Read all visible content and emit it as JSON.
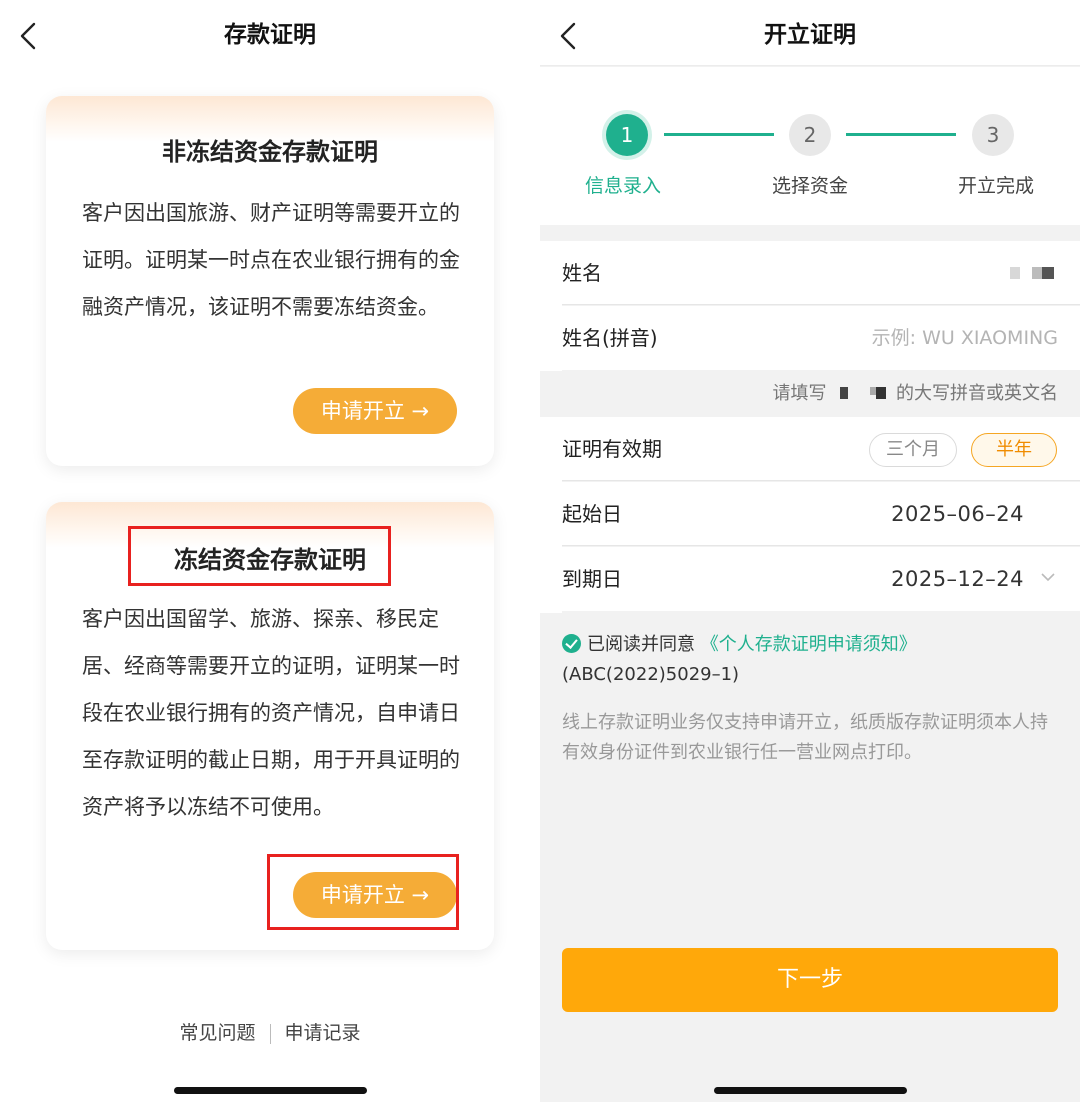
{
  "left": {
    "nav": {
      "title": "存款证明"
    },
    "card1": {
      "title": "非冻结资金存款证明",
      "description": "客户因出国旅游、财产证明等需要开立的证明。证明某一时点在农业银行拥有的金融资产情况，该证明不需要冻结资金。",
      "button": "申请开立 →"
    },
    "card2": {
      "title": "冻结资金存款证明",
      "description": "客户因出国留学、旅游、探亲、移民定居、经商等需要开立的证明，证明某一时段在农业银行拥有的资产情况，自申请日至存款证明的截止日期，用于开具证明的资产将予以冻结不可使用。",
      "button": "申请开立 →"
    },
    "footer": {
      "faq": "常见问题",
      "records": "申请记录"
    },
    "highlight_color": "#e8211f"
  },
  "right": {
    "nav": {
      "title": "开立证明"
    },
    "steps": [
      {
        "num": "1",
        "label": "信息录入",
        "active": true
      },
      {
        "num": "2",
        "label": "选择资金",
        "active": false
      },
      {
        "num": "3",
        "label": "开立完成",
        "active": false
      }
    ],
    "form": {
      "name_label": "姓名",
      "pinyin_label": "姓名(拼音)",
      "pinyin_placeholder": "示例: WU XIAOMING",
      "hint_prefix": "请填写",
      "hint_suffix": "的大写拼音或英文名",
      "validity_label": "证明有效期",
      "validity_options": [
        "三个月",
        "半年"
      ],
      "validity_selected": "半年",
      "start_label": "起始日",
      "start_value": "2025–06–24",
      "end_label": "到期日",
      "end_value": "2025–12–24"
    },
    "agreement": {
      "prefix": "已阅读并同意",
      "link": "《个人存款证明申请须知》",
      "suffix": "(ABC(2022)5029–1)"
    },
    "notice": "线上存款证明业务仅支持申请开立，纸质版存款证明须本人持有效身份证件到农业银行任一营业网点打印。",
    "next_button": "下一步",
    "accent": "#1fb08e",
    "primary": "#ffa80a"
  }
}
